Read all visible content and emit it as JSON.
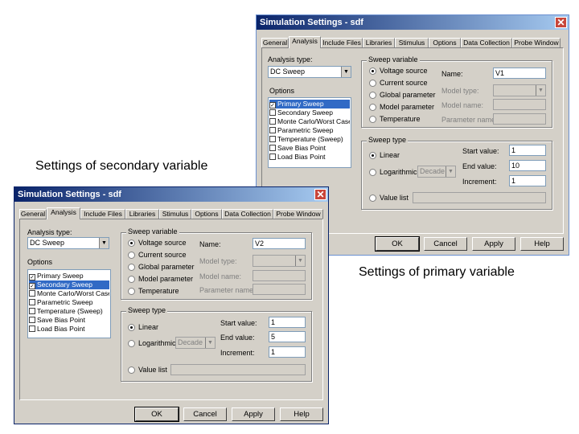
{
  "captions": {
    "secondary": "Settings of secondary variable",
    "primary": "Settings of primary variable"
  },
  "win_primary": {
    "title": "Simulation Settings - sdf",
    "close_glyph": "✕",
    "tabs": [
      "General",
      "Analysis",
      "Include Files",
      "Libraries",
      "Stimulus",
      "Options",
      "Data Collection",
      "Probe Window"
    ],
    "active_tab": "Analysis",
    "analysis_type_label": "Analysis type:",
    "analysis_type_value": "DC Sweep",
    "options_label": "Options",
    "options": [
      {
        "label": "Primary Sweep",
        "checked": true,
        "selected": true
      },
      {
        "label": "Secondary Sweep",
        "checked": false,
        "selected": false
      },
      {
        "label": "Monte Carlo/Worst Case",
        "checked": false,
        "selected": false
      },
      {
        "label": "Parametric Sweep",
        "checked": false,
        "selected": false
      },
      {
        "label": "Temperature (Sweep)",
        "checked": false,
        "selected": false
      },
      {
        "label": "Save Bias Point",
        "checked": false,
        "selected": false
      },
      {
        "label": "Load Bias Point",
        "checked": false,
        "selected": false
      }
    ],
    "sweep_variable_title": "Sweep variable",
    "sweep_variable_options": [
      "Voltage source",
      "Current source",
      "Global parameter",
      "Model parameter",
      "Temperature"
    ],
    "sweep_variable_selected": 0,
    "name_label": "Name:",
    "name_value": "V1",
    "model_type_label": "Model type:",
    "model_name_label": "Model name:",
    "parameter_name_label": "Parameter name:",
    "sweep_type_title": "Sweep type",
    "linear_label": "Linear",
    "log_label": "Logarithmic",
    "log_value": "Decade",
    "value_list_label": "Value list",
    "start_label": "Start value:",
    "start_value": "1",
    "end_label": "End value:",
    "end_value": "10",
    "inc_label": "Increment:",
    "inc_value": "1",
    "buttons": {
      "ok": "OK",
      "cancel": "Cancel",
      "apply": "Apply",
      "help": "Help"
    }
  },
  "win_secondary": {
    "title": "Simulation Settings - sdf",
    "close_glyph": "✕",
    "tabs": [
      "General",
      "Analysis",
      "Include Files",
      "Libraries",
      "Stimulus",
      "Options",
      "Data Collection",
      "Probe Window"
    ],
    "active_tab": "Analysis",
    "analysis_type_label": "Analysis type:",
    "analysis_type_value": "DC Sweep",
    "options_label": "Options",
    "options": [
      {
        "label": "Primary Sweep",
        "checked": true,
        "selected": false
      },
      {
        "label": "Secondary Sweep",
        "checked": true,
        "selected": true
      },
      {
        "label": "Monte Carlo/Worst Case",
        "checked": false,
        "selected": false
      },
      {
        "label": "Parametric Sweep",
        "checked": false,
        "selected": false
      },
      {
        "label": "Temperature (Sweep)",
        "checked": false,
        "selected": false
      },
      {
        "label": "Save Bias Point",
        "checked": false,
        "selected": false
      },
      {
        "label": "Load Bias Point",
        "checked": false,
        "selected": false
      }
    ],
    "sweep_variable_title": "Sweep variable",
    "sweep_variable_options": [
      "Voltage source",
      "Current source",
      "Global parameter",
      "Model parameter",
      "Temperature"
    ],
    "sweep_variable_selected": 0,
    "name_label": "Name:",
    "name_value": "V2",
    "model_type_label": "Model type:",
    "model_name_label": "Model name:",
    "parameter_name_label": "Parameter name:",
    "sweep_type_title": "Sweep type",
    "linear_label": "Linear",
    "log_label": "Logarithmic",
    "log_value": "Decade",
    "value_list_label": "Value list",
    "start_label": "Start value:",
    "start_value": "1",
    "end_label": "End value:",
    "end_value": "5",
    "inc_label": "Increment:",
    "inc_value": "1",
    "buttons": {
      "ok": "OK",
      "cancel": "Cancel",
      "apply": "Apply",
      "help": "Help"
    }
  }
}
